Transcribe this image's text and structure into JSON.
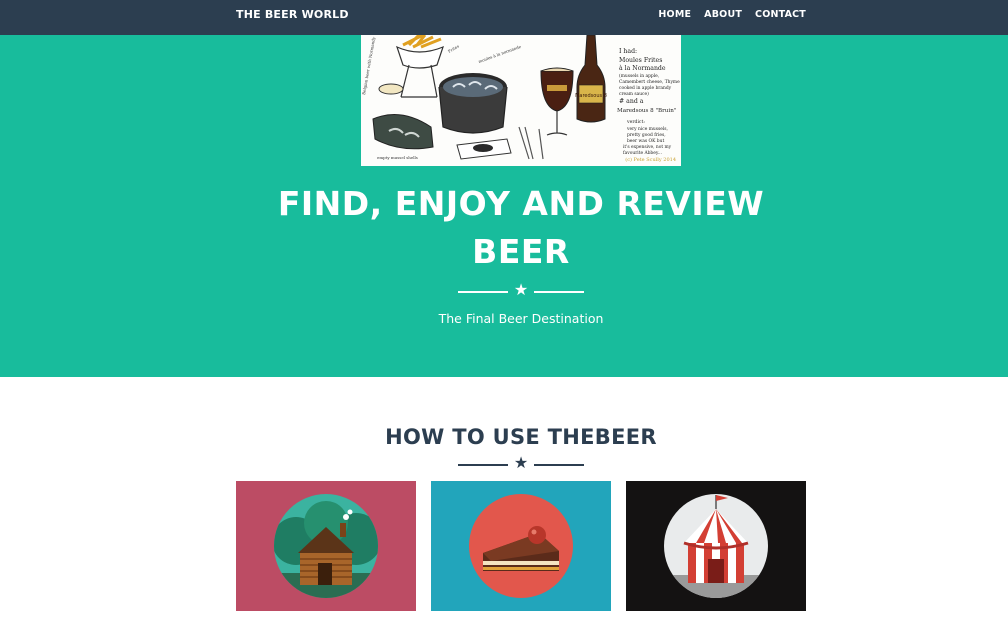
{
  "navbar": {
    "brand": "THE BEER WORLD",
    "links": [
      "HOME",
      "ABOUT",
      "CONTACT"
    ]
  },
  "hero": {
    "title": "FIND, ENJOY AND REVIEW BEER",
    "subtitle": "The Final Beer Destination",
    "image": {
      "menu_text": [
        "I had:",
        "Moules Frites",
        "à la Normande",
        "(mussels in apple,",
        "Camembert cheese, Thyme",
        "cooked in apple brandy",
        "cream sauce)",
        "# and a",
        "Maredsous 8 \"Bruin\"",
        "verdict:",
        "very nice mussels,",
        "pretty good fries,",
        "beer was OK but",
        "it's expensive, not my",
        "favourite Abbey..."
      ],
      "credit": "(c) Pete Scully 2014",
      "bottle_label": "Maredsous 8",
      "label_left": "Belgian beer with Normandy",
      "label_fries": "Frites",
      "label_mussels": "moules à la normande",
      "label_bowl": "empty mussel shells"
    }
  },
  "section": {
    "title": "HOW TO USE THEBEER"
  },
  "portfolio": [
    {
      "name": "cabin",
      "bg": "#bc4c64"
    },
    {
      "name": "cake",
      "bg": "#22a5bb"
    },
    {
      "name": "circus",
      "bg": "#141212"
    }
  ],
  "colors": {
    "navbar": "#2c3e50",
    "hero": "#18bc9c",
    "heading": "#2c3e50"
  }
}
